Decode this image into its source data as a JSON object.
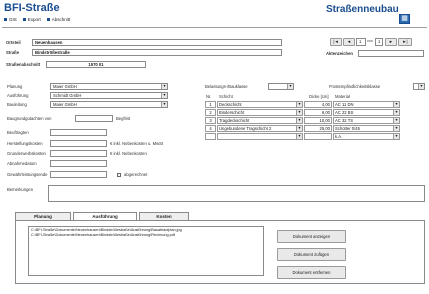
{
  "header": {
    "title": "BFI-Straße",
    "subtitle": "Straßenneubau",
    "toolbar": [
      "GIS",
      "Export",
      "Abschnitt"
    ],
    "accent": "#1a4d8f",
    "save_icon": "save-icon"
  },
  "location": {
    "ortsteil_label": "Ortsteil",
    "ortsteil_value": "Neuenhausen",
    "strasse_label": "Straße",
    "strasse_value": "Bindströßestraße",
    "abschnitt_label": "Straßenabschnitt",
    "abschnitt_value": "1570 01",
    "aktenzeichen_label": "Aktenzeichen",
    "aktenzeichen_value": ""
  },
  "navigation": {
    "first": "|◄",
    "prev": "◄",
    "record": "1",
    "of_text": "von",
    "total": "1",
    "next": "►",
    "last": "►|"
  },
  "left_form": {
    "planung_label": "Planung",
    "planung_value": "Maier GmbH",
    "ausfuehrung_label": "Ausführung",
    "ausfuehrung_value": "Schmidt GmbH",
    "bauleitung_label": "Bauleitung",
    "bauleitung_value": "Maier GmbH",
    "flaeche_label": "Baugrundgutachten von",
    "flaeche_value": "",
    "flaeche_suffix": "Begfrist",
    "beauftragt_label": "Beuftragten",
    "herstellung_label": "Herstellungskosten",
    "herstellung_suffix": "€ inkl. Nebenkosten u. MwSt",
    "grunderwerb_label": "Grunderwerbskosten",
    "grunderwerb_suffix": "€ inkl. Nebenkosten",
    "abnahme_label": "Abnahmedatum",
    "gewaehr_label": "Gewährleistungsende",
    "abgerechnet_label": "abgerechnet",
    "bemerkungen_label": "Bemerkungen"
  },
  "right_form": {
    "belastung_label": "Belastungs-/Bauklasse",
    "frost_label": "Frostempfindlichkeitsklasse",
    "col_nr": "Nr.",
    "col_schicht": "Schicht",
    "col_dicke": "Dicke [cm]",
    "col_material": "Material",
    "layers": [
      {
        "nr": "1",
        "schicht": "Deckschicht",
        "dicke": "4,00",
        "material": "AC 11 DN"
      },
      {
        "nr": "2",
        "schicht": "Binderschicht",
        "dicke": "6,00",
        "material": "AC 22 BS"
      },
      {
        "nr": "3",
        "schicht": "Tragdeckschicht",
        "dicke": "10,00",
        "material": "AC 32 TS"
      },
      {
        "nr": "4",
        "schicht": "Ungebundene Tragschicht 2",
        "dicke": "25,00",
        "material": "Schotter 0/45"
      },
      {
        "nr": "",
        "schicht": "",
        "dicke": "",
        "material": "k.A."
      }
    ]
  },
  "tabs": [
    "Planung",
    "Ausführung",
    "Kosten"
  ],
  "documents": {
    "files": [
      "C:\\BFI-Straße\\Dokumente\\Neuenhausen\\Bindströßestraße\\Ausführung\\Bauablaufplan.jpg",
      "C:\\BFI-Straße\\Dokumente\\Neuenhausen\\Bindströßestraße\\Ausführung\\Rechnung.pdf"
    ],
    "btn_show": "Dokument anzeigen",
    "btn_add": "Dokument zufügen",
    "btn_remove": "Dokument entfernen"
  }
}
